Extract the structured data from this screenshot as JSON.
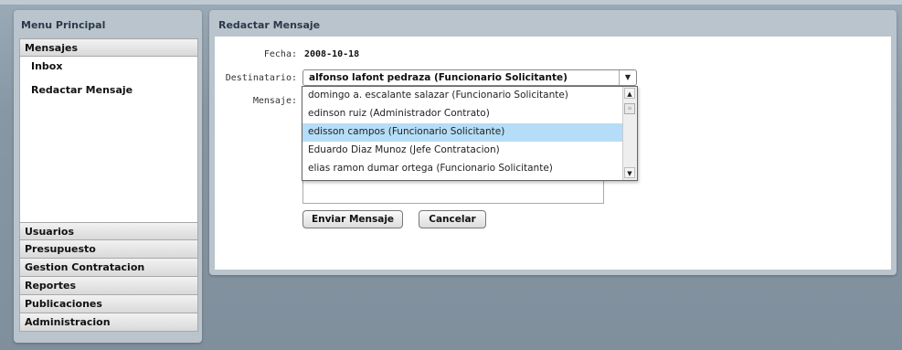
{
  "sidebar": {
    "title": "Menu Principal",
    "sections": [
      {
        "label": "Mensajes"
      },
      {
        "label": "Usuarios"
      },
      {
        "label": "Presupuesto"
      },
      {
        "label": "Gestion Contratacion"
      },
      {
        "label": "Reportes"
      },
      {
        "label": "Publicaciones"
      },
      {
        "label": "Administracion"
      }
    ],
    "mensajes_items": [
      "Inbox",
      "Redactar Mensaje"
    ]
  },
  "main": {
    "title": "Redactar Mensaje",
    "fecha_label": "Fecha:",
    "fecha_value": "2008-10-18",
    "destinatario_label": "Destinatario:",
    "destinatario_selected": "alfonso lafont pedraza (Funcionario Solicitante)",
    "mensaje_label": "Mensaje:",
    "options": [
      "domingo a. escalante salazar  (Funcionario Solicitante)",
      "edinson ruiz  (Administrador Contrato)",
      "edisson campos (Funcionario Solicitante)",
      "Eduardo Diaz Munoz (Jefe Contratacion)",
      "elias ramon dumar ortega (Funcionario Solicitante)"
    ],
    "highlighted_option_index": 2,
    "send_label": "Enviar Mensaje",
    "cancel_label": "Cancelar"
  },
  "icons": {
    "dropdown_arrow": "▼",
    "scroll_up": "▲",
    "scroll_down": "▼",
    "scroll_thumb": "≡"
  },
  "colors": {
    "highlight": "#b5ddf7",
    "panel": "#b9c4cc",
    "background": "#8797a4"
  }
}
